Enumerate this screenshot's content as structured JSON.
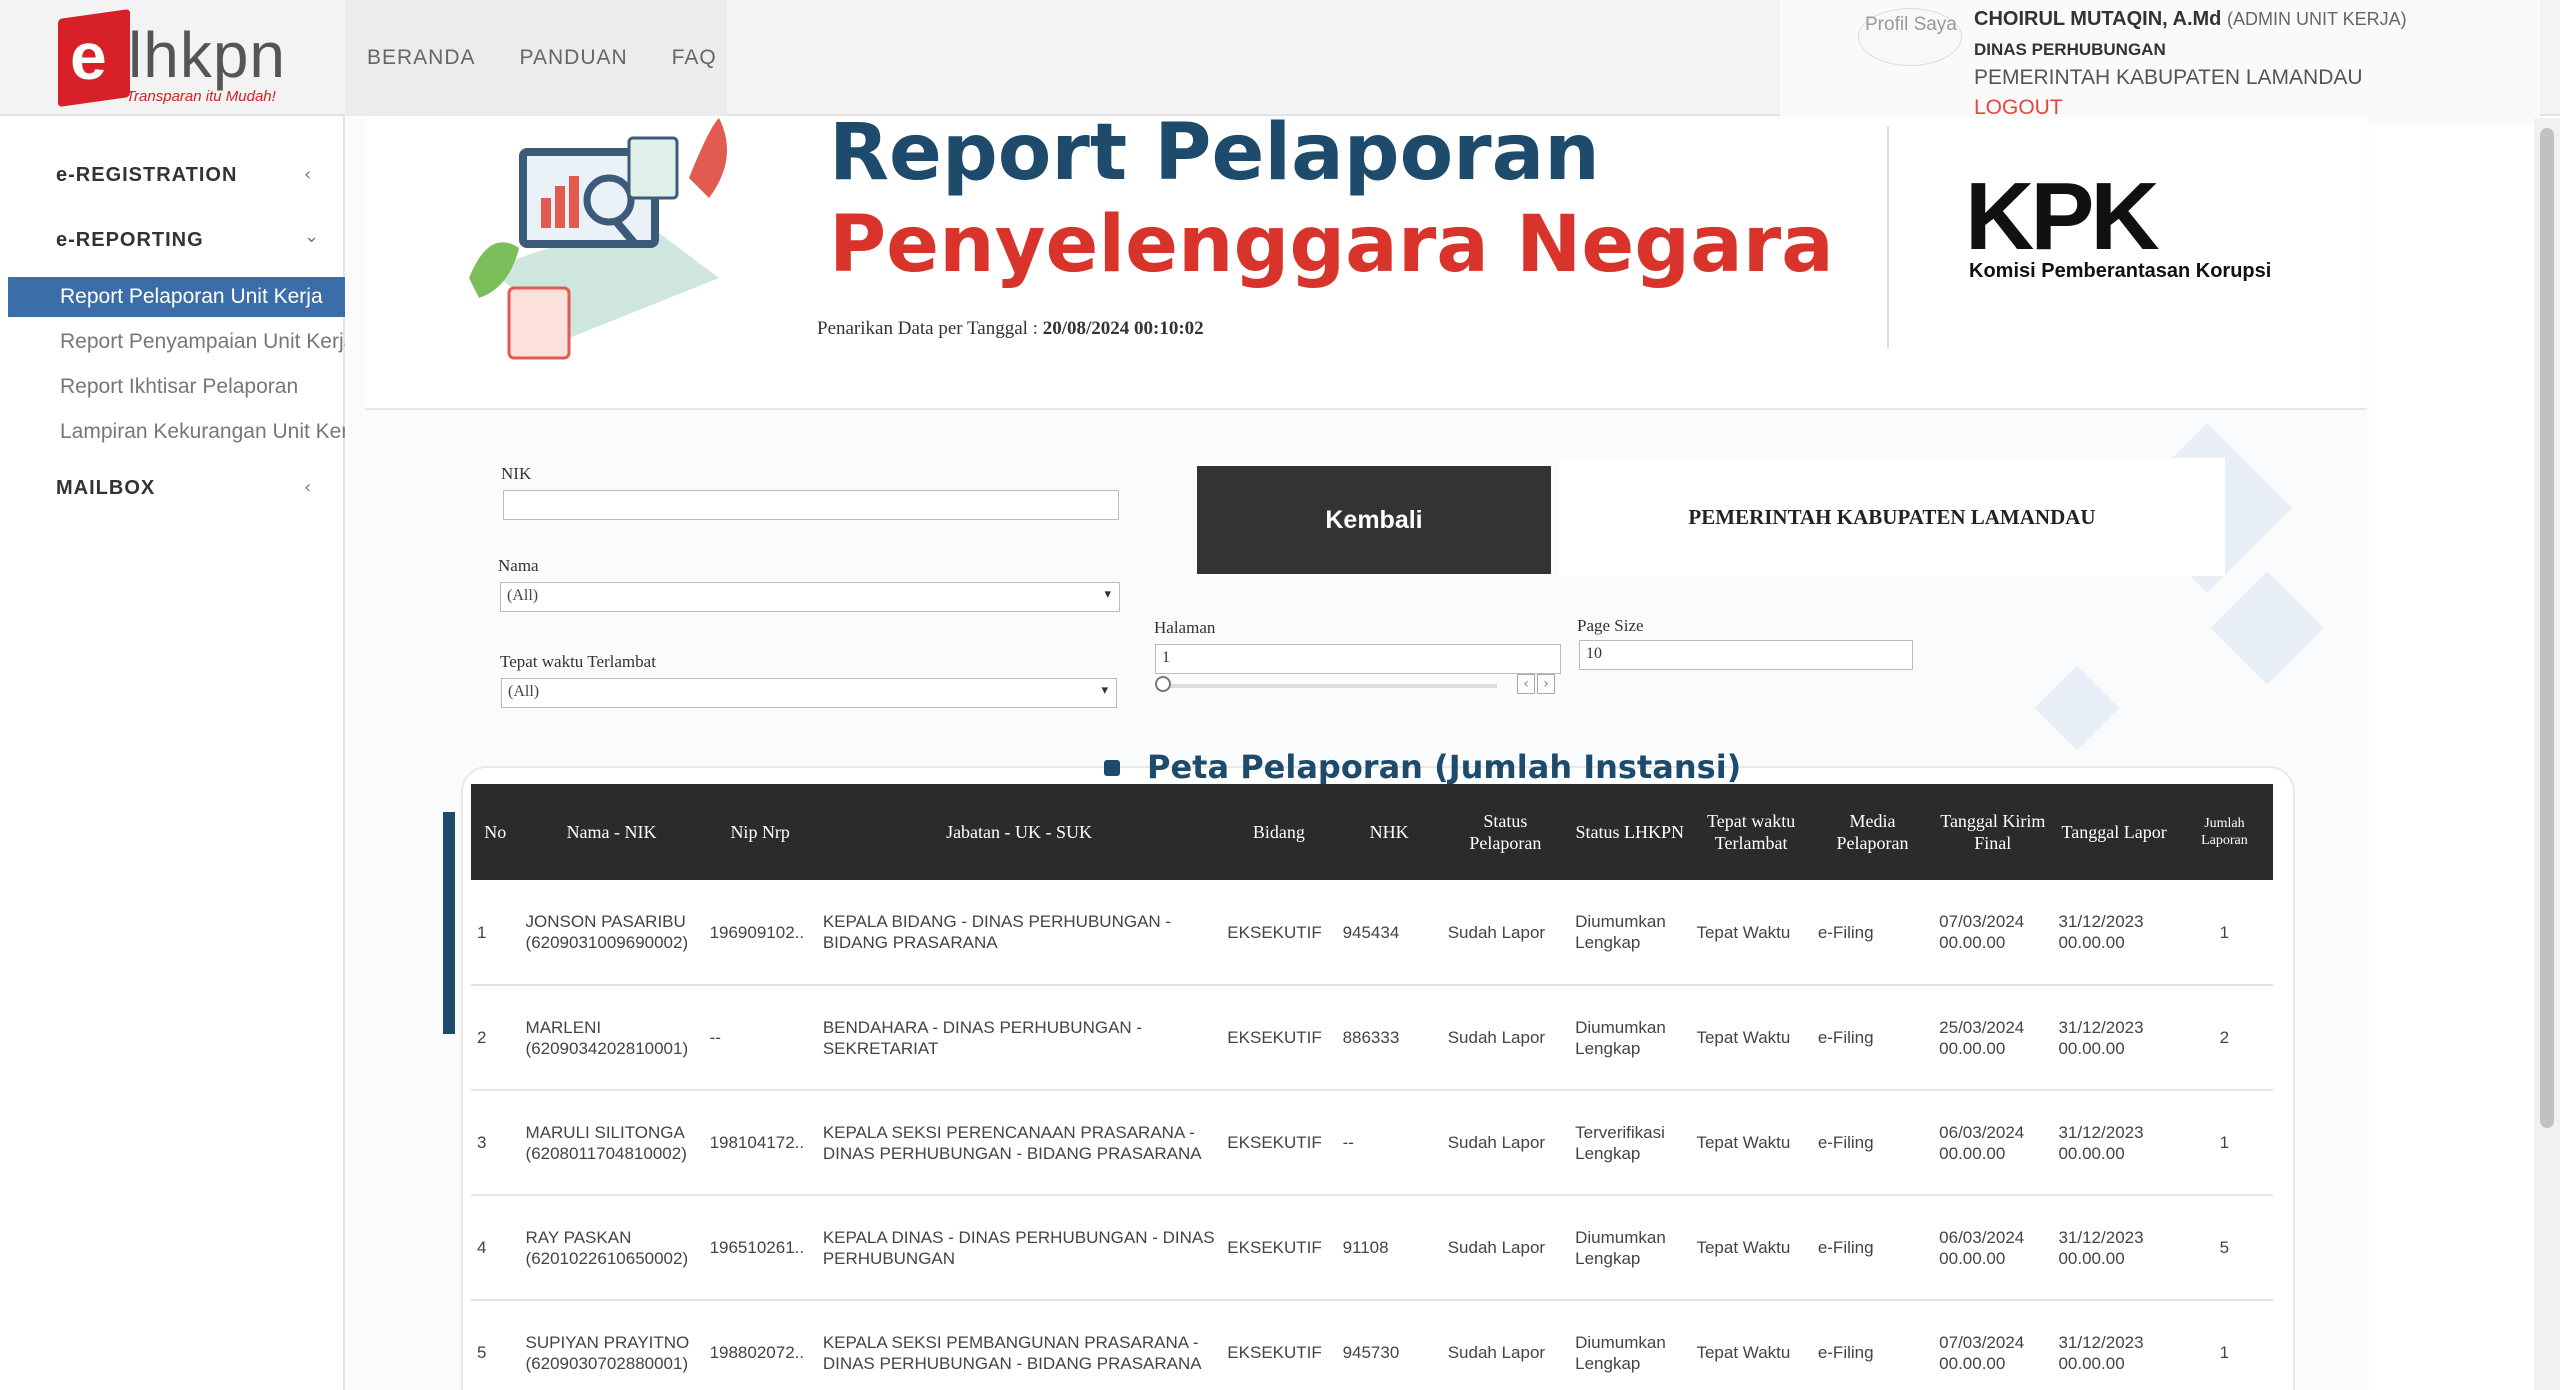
{
  "logo": {
    "letter": "e",
    "name": "lhkpn",
    "tagline": "Transparan itu Mudah!"
  },
  "topnav": [
    "BERANDA",
    "PANDUAN",
    "FAQ"
  ],
  "profile": {
    "avatar_alt": "Profil Saya",
    "name": "CHOIRUL MUTAQIN, A.Md",
    "role": "(ADMIN UNIT KERJA)",
    "dinas": "DINAS PERHUBUNGAN",
    "pemerintah": "PEMERINTAH KABUPATEN LAMANDAU",
    "logout": "LOGOUT"
  },
  "sidebar": {
    "registration": "e-REGISTRATION",
    "reporting": "e-REPORTING",
    "items": [
      "Report Pelaporan Unit Kerja",
      "Report Penyampaian Unit Kerja",
      "Report Ikhtisar Pelaporan",
      "Lampiran Kekurangan Unit Kerja"
    ],
    "mailbox": "MAILBOX"
  },
  "banner": {
    "title1": "Report Pelaporan",
    "title2": "Penyelenggara Negara",
    "pull_label": "Penarikan Data per Tanggal :",
    "pull_value": "20/08/2024 00:10:02",
    "kpk": "KPK",
    "kpk_sub": "Komisi Pemberantasan Korupsi"
  },
  "filters": {
    "nik_label": "NIK",
    "nik_value": "",
    "nama_label": "Nama",
    "nama_value": "(All)",
    "tepat_label": "Tepat waktu Terlambat",
    "tepat_value": "(All)",
    "halaman_label": "Halaman",
    "halaman_value": "1",
    "pagesize_label": "Page Size",
    "pagesize_value": "10",
    "kembali": "Kembali",
    "pemerintah": "PEMERINTAH KABUPATEN LAMANDAU"
  },
  "section_title": "Peta Pelaporan (Jumlah Instansi)",
  "table": {
    "headers": [
      "No",
      "Nama - NIK",
      "Nip Nrp",
      "Jabatan - UK - SUK",
      "Bidang",
      "NHK",
      "Status Pelaporan",
      "Status LHKPN",
      "Tepat waktu Terlambat",
      "Media Pelaporan",
      "Tanggal Kirim Final",
      "Tanggal Lapor",
      "Jumlah Laporan"
    ],
    "rows": [
      [
        "1",
        "JONSON PASARIBU (6209031009690002)",
        "196909102..",
        "KEPALA BIDANG - DINAS PERHUBUNGAN - BIDANG PRASARANA",
        "EKSEKUTIF",
        "945434",
        "Sudah Lapor",
        "Diumumkan Lengkap",
        "Tepat Waktu",
        "e-Filing",
        "07/03/2024 00.00.00",
        "31/12/2023 00.00.00",
        "1"
      ],
      [
        "2",
        "MARLENI (6209034202810001)",
        "--",
        "BENDAHARA - DINAS PERHUBUNGAN - SEKRETARIAT",
        "EKSEKUTIF",
        "886333",
        "Sudah Lapor",
        "Diumumkan Lengkap",
        "Tepat Waktu",
        "e-Filing",
        "25/03/2024 00.00.00",
        "31/12/2023 00.00.00",
        "2"
      ],
      [
        "3",
        "MARULI SILITONGA (6208011704810002)",
        "198104172..",
        "KEPALA SEKSI PERENCANAAN PRASARANA - DINAS PERHUBUNGAN - BIDANG PRASARANA",
        "EKSEKUTIF",
        "--",
        "Sudah Lapor",
        "Terverifikasi Lengkap",
        "Tepat Waktu",
        "e-Filing",
        "06/03/2024 00.00.00",
        "31/12/2023 00.00.00",
        "1"
      ],
      [
        "4",
        "RAY PASKAN (6201022610650002)",
        "196510261..",
        "KEPALA DINAS - DINAS PERHUBUNGAN - DINAS PERHUBUNGAN",
        "EKSEKUTIF",
        "91108",
        "Sudah Lapor",
        "Diumumkan Lengkap",
        "Tepat Waktu",
        "e-Filing",
        "06/03/2024 00.00.00",
        "31/12/2023 00.00.00",
        "5"
      ],
      [
        "5",
        "SUPIYAN PRAYITNO (6209030702880001)",
        "198802072..",
        "KEPALA SEKSI PEMBANGUNAN PRASARANA - DINAS PERHUBUNGAN - BIDANG PRASARANA",
        "EKSEKUTIF",
        "945730",
        "Sudah Lapor",
        "Diumumkan Lengkap",
        "Tepat Waktu",
        "e-Filing",
        "07/03/2024 00.00.00",
        "31/12/2023 00.00.00",
        "1"
      ]
    ]
  },
  "colors": {
    "brand_red": "#d72027",
    "navy": "#1e4b6b",
    "sidebar_active": "#3b6ea8",
    "title_red": "#d9342b"
  }
}
